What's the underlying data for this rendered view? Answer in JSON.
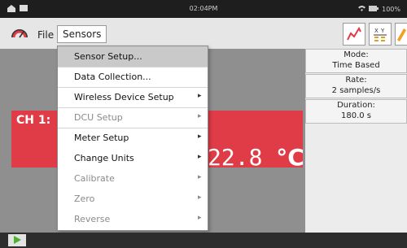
{
  "status_bar": {
    "time": "02:04PM",
    "battery": "100%"
  },
  "toolbar": {
    "file_label": "File",
    "sensors_label": "Sensors"
  },
  "menu": {
    "items": [
      {
        "label": "Sensor Setup...",
        "submenu": false,
        "disabled": false,
        "selected": true
      },
      {
        "label": "Data Collection...",
        "submenu": false,
        "disabled": false,
        "selected": false
      },
      {
        "label": "Wireless Device Setup",
        "submenu": true,
        "disabled": false,
        "selected": false
      },
      {
        "label": "DCU Setup",
        "submenu": true,
        "disabled": true,
        "selected": false
      },
      {
        "label": "Meter Setup",
        "submenu": true,
        "disabled": false,
        "selected": false
      },
      {
        "label": "Change Units",
        "submenu": true,
        "disabled": false,
        "selected": false
      },
      {
        "label": "Calibrate",
        "submenu": true,
        "disabled": true,
        "selected": false
      },
      {
        "label": "Zero",
        "submenu": true,
        "disabled": true,
        "selected": false
      },
      {
        "label": "Reverse",
        "submenu": true,
        "disabled": true,
        "selected": false
      }
    ],
    "arrow_glyph": "▸"
  },
  "meter": {
    "channel_label": "CH 1:",
    "value": "22.8 ",
    "unit": "°C"
  },
  "panel": {
    "mode": {
      "label": "Mode:",
      "value": "Time Based"
    },
    "rate": {
      "label": "Rate:",
      "value": "2 samples/s"
    },
    "duration": {
      "label": "Duration:",
      "value": "180.0 s"
    }
  },
  "colors": {
    "accent": "#e03c48",
    "play": "#4bb22c"
  }
}
